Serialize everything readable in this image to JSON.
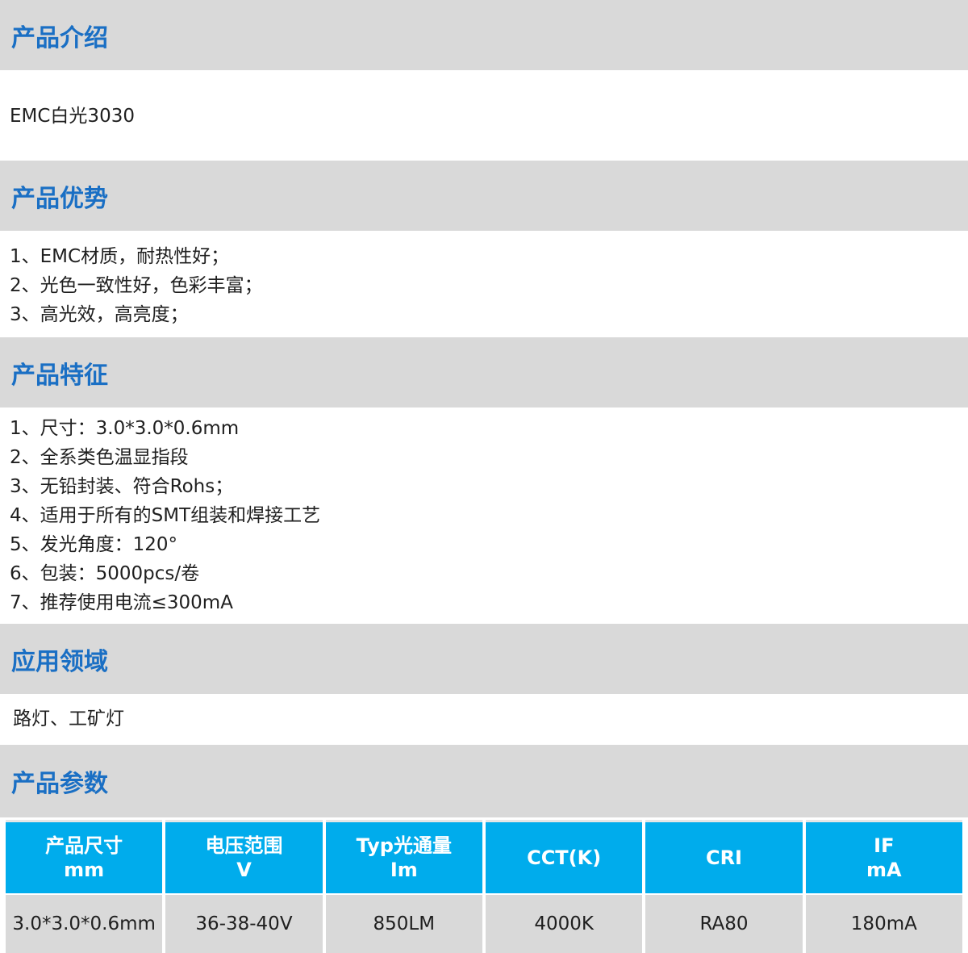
{
  "sections": {
    "intro": {
      "title": "产品介绍",
      "text": "EMC白光3030"
    },
    "advantages": {
      "title": "产品优势",
      "items": [
        "1、EMC材质，耐热性好；",
        "2、光色一致性好，色彩丰富；",
        "3、高光效，高亮度；"
      ]
    },
    "features": {
      "title": "产品特征",
      "items": [
        "1、尺寸：3.0*3.0*0.6mm",
        "2、全系类色温显指段",
        "3、无铅封装、符合Rohs；",
        "4、适用于所有的SMT组装和焊接工艺",
        "5、发光角度：120°",
        "6、包装：5000pcs/卷",
        "7、推荐使用电流≤300mA"
      ]
    },
    "applications": {
      "title": "应用领域",
      "text": "路灯、工矿灯"
    },
    "parameters": {
      "title": "产品参数",
      "headers": [
        {
          "line1": "产品尺寸",
          "line2": "mm"
        },
        {
          "line1": "电压范围",
          "line2": "V"
        },
        {
          "line1": "Typ光通量",
          "line2": "Im"
        },
        {
          "line1": "CCT(K)",
          "line2": ""
        },
        {
          "line1": "CRI",
          "line2": ""
        },
        {
          "line1": "IF",
          "line2": "mA"
        }
      ],
      "row": [
        "3.0*3.0*0.6mm",
        "36-38-40V",
        "850LM",
        "4000K",
        "RA80",
        "180mA"
      ]
    }
  },
  "colors": {
    "header_bg": "#d9d9d9",
    "header_text": "#1a6fc4",
    "table_header_bg": "#00acec",
    "table_header_text": "#ffffff"
  }
}
